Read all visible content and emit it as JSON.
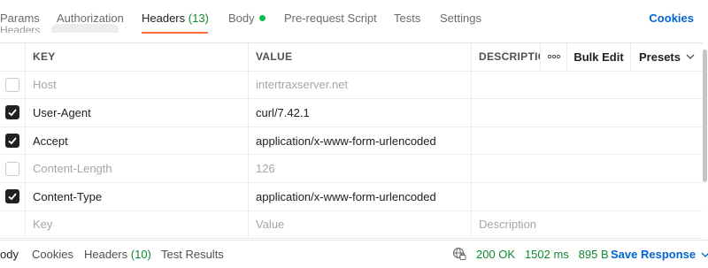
{
  "request_tabs": [
    {
      "label": "Params"
    },
    {
      "label": "Authorization"
    },
    {
      "label": "Headers",
      "count": "(13)"
    },
    {
      "label": "Body"
    },
    {
      "label": "Pre-request Script"
    },
    {
      "label": "Tests"
    },
    {
      "label": "Settings"
    }
  ],
  "cookies_label": "Cookies",
  "section_peek": "Headers",
  "table": {
    "columns": {
      "key": "KEY",
      "value": "VALUE",
      "description": "DESCRIPTIC"
    },
    "more_icon": "ooo",
    "bulk_edit": "Bulk Edit",
    "presets": "Presets",
    "rows": [
      {
        "checked": false,
        "key": "Host",
        "value": "intertraxserver.net",
        "description": ""
      },
      {
        "checked": true,
        "key": "User-Agent",
        "value": "curl/7.42.1",
        "description": ""
      },
      {
        "checked": true,
        "key": "Accept",
        "value": "application/x-www-form-urlencoded",
        "description": ""
      },
      {
        "checked": false,
        "key": "Content-Length",
        "value": "126",
        "description": ""
      },
      {
        "checked": true,
        "key": "Content-Type",
        "value": "application/x-www-form-urlencoded",
        "description": ""
      }
    ],
    "placeholders": {
      "key": "Key",
      "value": "Value",
      "description": "Description"
    }
  },
  "response": {
    "tabs": [
      {
        "label": "ody"
      },
      {
        "label": "Cookies"
      },
      {
        "label": "Headers",
        "count": "(10)"
      },
      {
        "label": "Test Results"
      }
    ],
    "status": "200 OK",
    "time": "1502 ms",
    "size": "895 B",
    "save_label": "Save Response"
  },
  "colors": {
    "accent": "#ff6c37",
    "link": "#0265d2",
    "success": "#0f8a2e",
    "dot": "#0cbb52"
  }
}
